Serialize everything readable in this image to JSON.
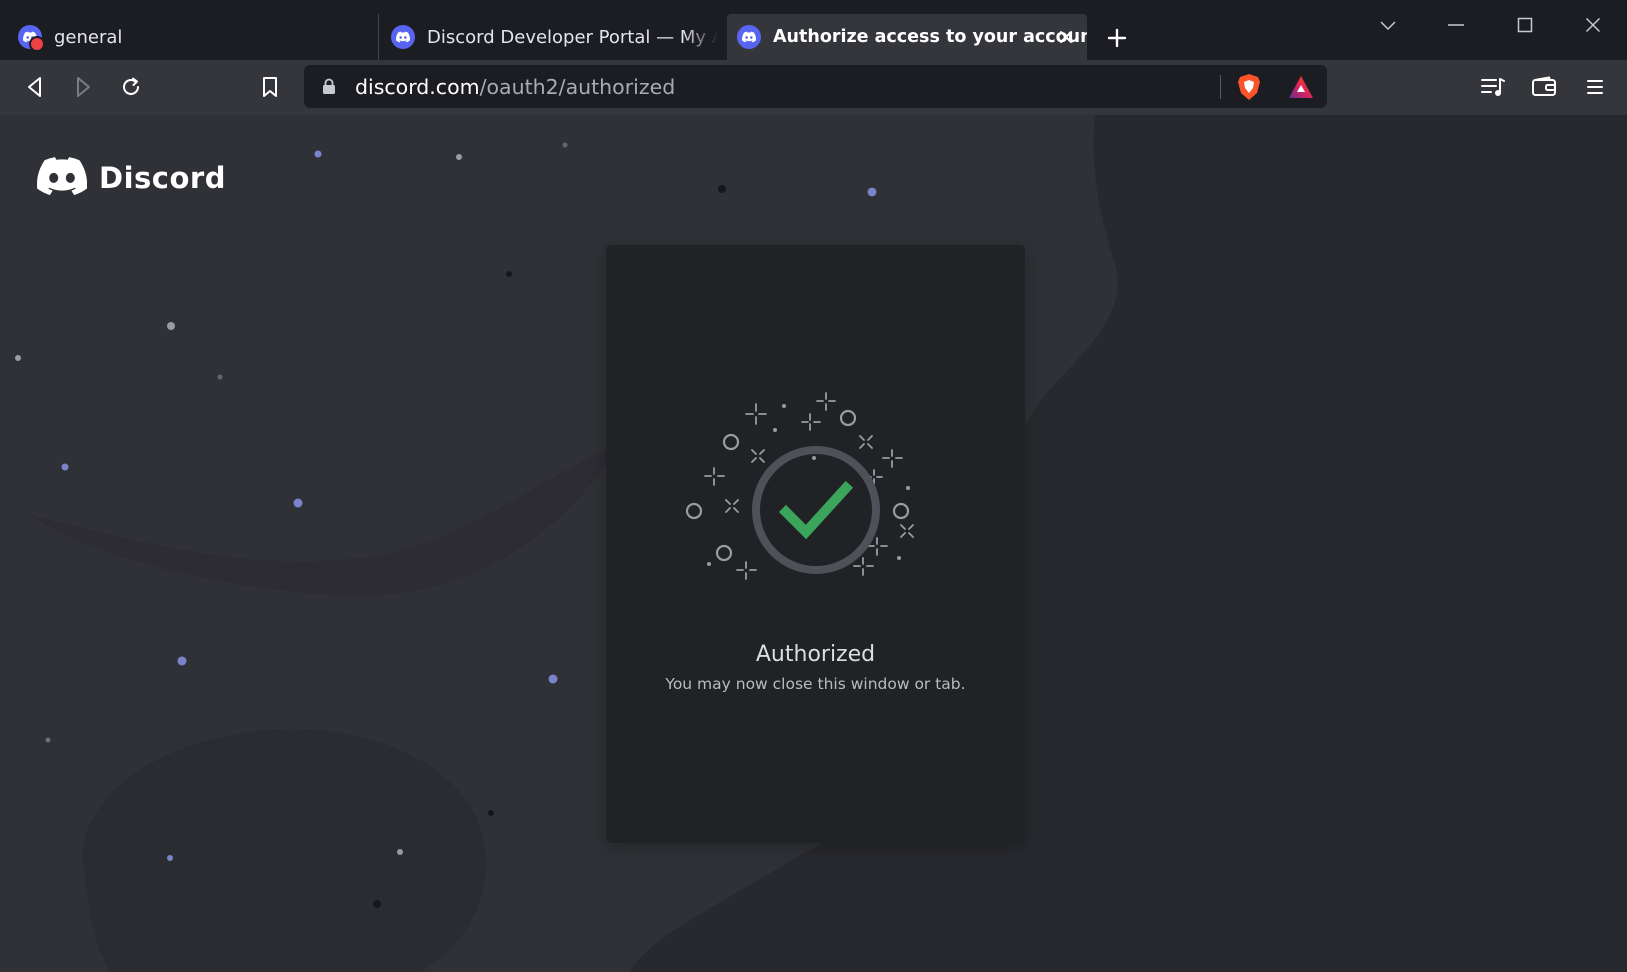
{
  "browser": {
    "tabs": [
      {
        "title": "general",
        "icon": "discord-notification-icon",
        "active": false
      },
      {
        "title": "Discord Developer Portal — My Applications",
        "icon": "discord-icon",
        "active": false
      },
      {
        "title": "Authorize access to your account",
        "icon": "discord-icon",
        "active": true
      }
    ],
    "address_bar": {
      "host": "discord.com",
      "path": "/oauth2/authorized"
    }
  },
  "page": {
    "brand": "Discord",
    "card": {
      "title": "Authorized",
      "subtitle": "You may now close this window or tab."
    }
  },
  "colors": {
    "discord_blurple": "#5865f2",
    "success_green": "#3ba55c",
    "page_bg": "#2f3136",
    "card_bg": "#202225"
  }
}
